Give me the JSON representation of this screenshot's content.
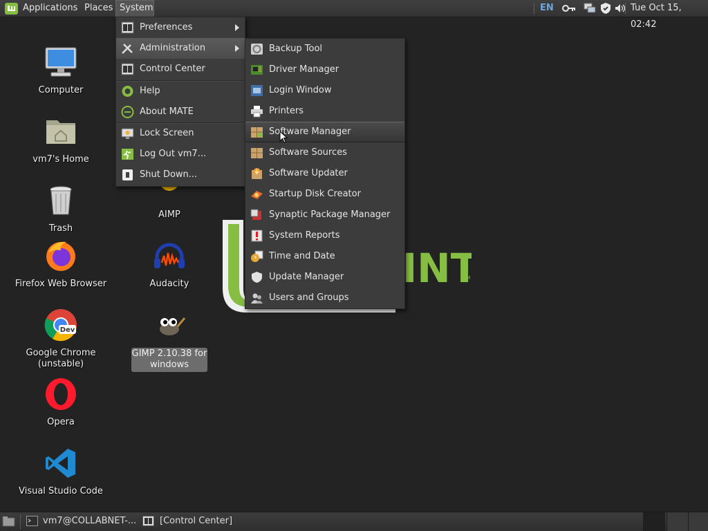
{
  "top_panel": {
    "menus": [
      "Applications",
      "Places",
      "System"
    ],
    "keyboard_layout": "EN",
    "clock": "Tue Oct 15, 02:42",
    "tray_icons": [
      "key-icon",
      "network-icon",
      "shield-icon",
      "volume-icon"
    ]
  },
  "desktop": {
    "icons": [
      {
        "label": "Computer",
        "icon": "computer-icon"
      },
      {
        "label": "vm7's Home",
        "icon": "home-folder-icon"
      },
      {
        "label": "Trash",
        "icon": "trash-icon"
      },
      {
        "label": "Firefox Web Browser",
        "icon": "firefox-icon"
      },
      {
        "label": "Google Chrome\n(unstable)",
        "icon": "chrome-dev-icon"
      },
      {
        "label": "Opera",
        "icon": "opera-icon"
      },
      {
        "label": "Visual Studio Code",
        "icon": "vscode-icon"
      },
      {
        "label": "AIMP",
        "icon": "aimp-icon"
      },
      {
        "label": "Audacity",
        "icon": "audacity-icon"
      },
      {
        "label": "GIMP 2.10.38 for\nwindows",
        "icon": "gimp-icon",
        "selected": true
      }
    ]
  },
  "system_menu": {
    "items": [
      {
        "label": "Preferences",
        "icon": "preferences-icon",
        "submenu": true
      },
      {
        "label": "Administration",
        "icon": "administration-icon",
        "submenu": true,
        "active": true
      },
      {
        "label": "Control Center",
        "icon": "control-center-icon"
      },
      {
        "label": "Help",
        "icon": "help-icon"
      },
      {
        "label": "About MATE",
        "icon": "about-icon"
      },
      {
        "label": "Lock Screen",
        "icon": "lock-screen-icon"
      },
      {
        "label": "Log Out vm7...",
        "icon": "logout-icon"
      },
      {
        "label": "Shut Down...",
        "icon": "shutdown-icon"
      }
    ]
  },
  "administration_menu": {
    "items": [
      {
        "label": "Backup Tool",
        "icon": "backup-icon"
      },
      {
        "label": "Driver Manager",
        "icon": "driver-icon"
      },
      {
        "label": "Login Window",
        "icon": "login-window-icon"
      },
      {
        "label": "Printers",
        "icon": "printer-icon"
      },
      {
        "label": "Software Manager",
        "icon": "software-manager-icon",
        "hovered": true
      },
      {
        "label": "Software Sources",
        "icon": "software-sources-icon"
      },
      {
        "label": "Software Updater",
        "icon": "software-updater-icon"
      },
      {
        "label": "Startup Disk Creator",
        "icon": "startup-disk-icon"
      },
      {
        "label": "Synaptic Package Manager",
        "icon": "synaptic-icon"
      },
      {
        "label": "System Reports",
        "icon": "system-reports-icon"
      },
      {
        "label": "Time and Date",
        "icon": "time-date-icon"
      },
      {
        "label": "Update Manager",
        "icon": "update-manager-icon"
      },
      {
        "label": "Users and Groups",
        "icon": "users-groups-icon"
      }
    ]
  },
  "taskbar": {
    "tasks": [
      {
        "label": "vm7@COLLABNET-...",
        "icon": "terminal-icon"
      },
      {
        "label": "[Control Center]",
        "icon": "control-center-icon"
      }
    ]
  },
  "colors": {
    "desktop_bg": "#232323",
    "mint_green": "#86be43",
    "menu_bg": "#3c3c3c",
    "keyboard_layout": "#6ea7e0"
  }
}
